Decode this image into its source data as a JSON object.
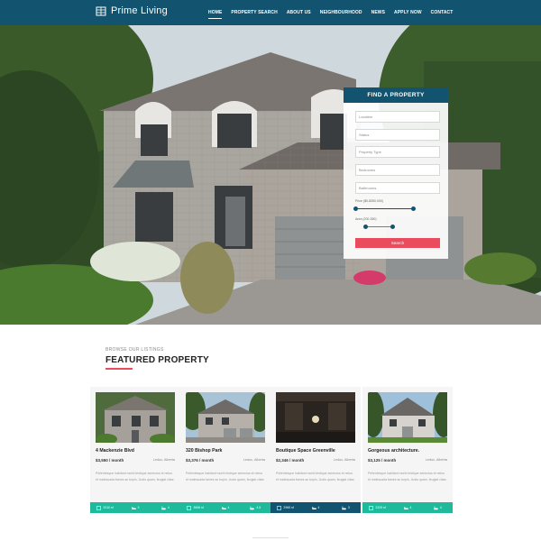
{
  "brand": {
    "name": "Prime Living"
  },
  "nav": {
    "items": [
      {
        "label": "HOME",
        "active": true
      },
      {
        "label": "PROPERTY SEARCH"
      },
      {
        "label": "ABOUT US"
      },
      {
        "label": "NEIGHBOURHOOD"
      },
      {
        "label": "NEWS"
      },
      {
        "label": "APPLY NOW"
      },
      {
        "label": "CONTACT"
      }
    ]
  },
  "find": {
    "title": "FIND A PROPERTY",
    "fields": [
      {
        "placeholder": "Location"
      },
      {
        "placeholder": "Status"
      },
      {
        "placeholder": "Property Type"
      },
      {
        "placeholder": "Bedrooms"
      },
      {
        "placeholder": "Bathrooms"
      }
    ],
    "price_label": "Price ($0-$350,000)",
    "area_label": "Area (200-350)",
    "search_label": "Search"
  },
  "featured": {
    "eyebrow": "BROWSE OUR LISTINGS",
    "title": "FEATURED PROPERTY"
  },
  "properties": [
    {
      "title": "4 Mackenzie Blvd",
      "price": "$3,550 / month",
      "location": "Leduc, Alberta",
      "description": "Pellentesque habitant morbi tristique senectus et netus et malesuada fames ac turpis. Justo quam, feugiat vitae.",
      "area": "3310 sf",
      "beds": "3",
      "baths": "4",
      "bar_color": "#1fb99b"
    },
    {
      "title": "320 Bishop Park",
      "price": "$3,376 / month",
      "location": "Leduc, Alberta",
      "description": "Pellentesque habitant morbi tristique senectus et netus et malesuada fames ac turpis. Justo quam, feugiat vitae.",
      "area": "3656 sf",
      "beds": "4",
      "baths": "4.5",
      "bar_color": "#1fb99b"
    },
    {
      "title": "Boutique Space Greenville",
      "price": "$2,346 / month",
      "location": "Leduc, Alberta",
      "description": "Pellentesque habitant morbi tristique senectus et netus et malesuada fames ac turpis. Justo quam, feugiat vitae.",
      "area": "2960 sf",
      "beds": "4",
      "baths": "3",
      "bar_color": "#12546f"
    },
    {
      "title": "Gorgeous architecture.",
      "price": "$3,125 / month",
      "location": "Leduc, Alberta",
      "description": "Pellentesque habitant morbi tristique senectus et netus et malesuada fames ac turpis. Justo quam, feugiat vitae.",
      "area": "3329 sf",
      "beds": "4",
      "baths": "4",
      "bar_color": "#1fb99b"
    }
  ],
  "colors": {
    "primary": "#12546f",
    "accent": "#ea4b5d",
    "teal": "#1fb99b"
  }
}
